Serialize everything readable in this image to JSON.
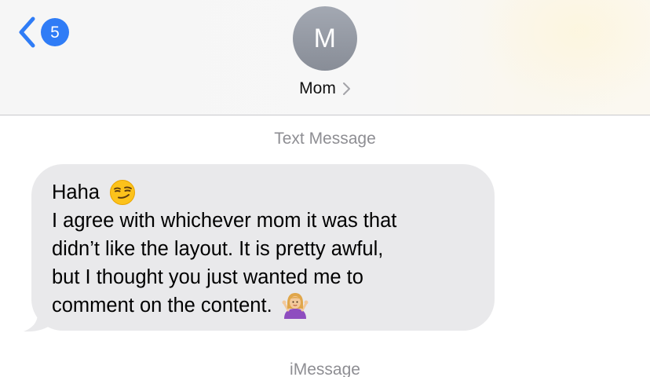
{
  "nav": {
    "back_icon": "chevron-left-icon",
    "unread_count": "5",
    "accent_color": "#2f7cf6"
  },
  "contact": {
    "initial": "M",
    "name": "Mom",
    "name_chevron_icon": "chevron-right-icon"
  },
  "conversation": {
    "service_label_top": "Text Message",
    "service_label_bottom": "iMessage",
    "messages": [
      {
        "direction": "incoming",
        "lines": [
          "Haha",
          "I agree with whichever mom it was that",
          "didn’t like the layout. It is pretty awful,",
          "but I thought you just wanted me to",
          "comment on the content."
        ],
        "emojis": [
          "smirking-face-emoji",
          "person-shrugging-emoji"
        ]
      }
    ]
  }
}
